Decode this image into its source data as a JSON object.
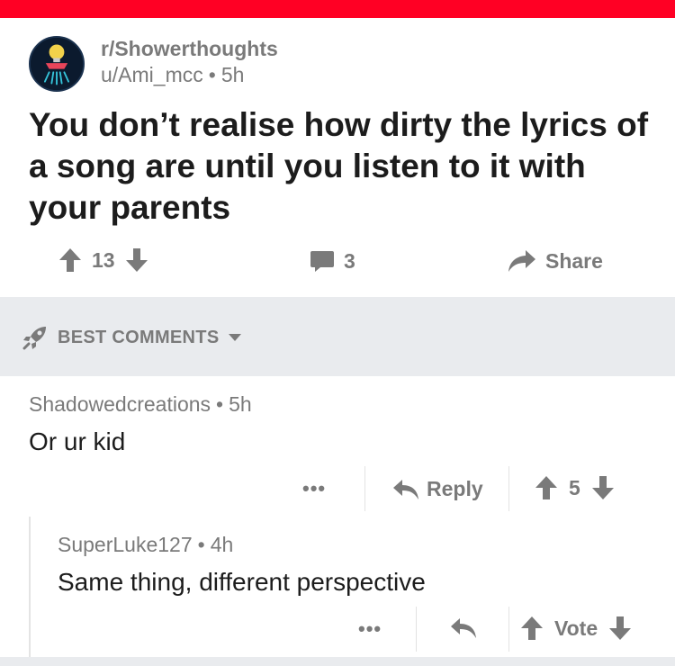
{
  "colors": {
    "topbar": "#ff0024",
    "muted": "#7a7a7a",
    "text": "#1c1c1c",
    "sort_bg": "#e9ebee"
  },
  "post": {
    "subreddit": "r/Showerthoughts",
    "author": "u/Ami_mcc",
    "separator": "•",
    "age": "5h",
    "title": "You don’t realise how dirty the lyrics of a song are until you listen to it with your parents",
    "upvote_icon": "arrow-up-icon",
    "score": "13",
    "downvote_icon": "arrow-down-icon",
    "comments_icon": "speech-bubble-icon",
    "comment_count": "3",
    "share_icon": "share-arrow-icon",
    "share_label": "Share"
  },
  "sort": {
    "icon": "rocket-icon",
    "label": "BEST COMMENTS",
    "caret_icon": "caret-down-icon"
  },
  "comments": [
    {
      "author": "Shadowedcreations",
      "separator": "•",
      "age": "5h",
      "body": "Or ur kid",
      "more_label": "•••",
      "reply_icon": "reply-arrow-icon",
      "reply_label": "Reply",
      "score": "5"
    },
    {
      "author": "SuperLuke127",
      "separator": "•",
      "age": "4h",
      "body": "Same thing, different perspective",
      "more_label": "•••",
      "reply_icon": "reply-arrow-icon",
      "vote_label": "Vote"
    }
  ]
}
